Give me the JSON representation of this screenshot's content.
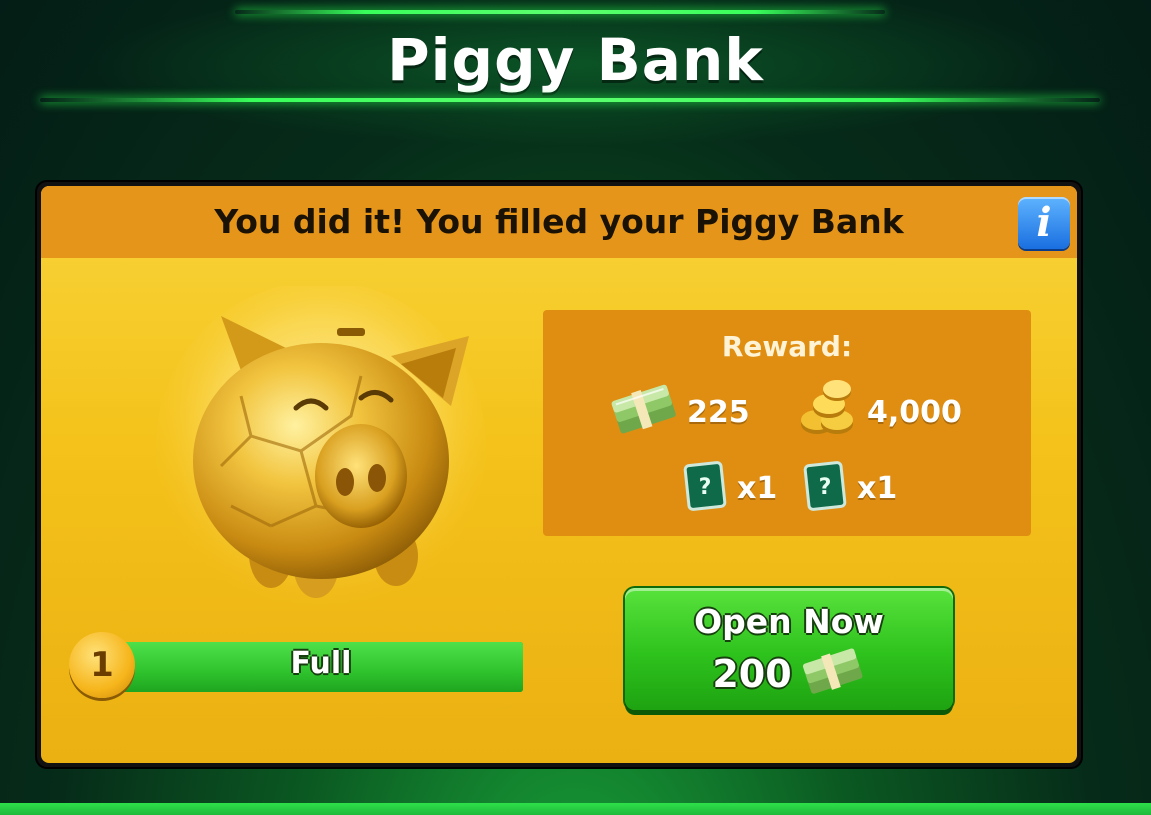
{
  "title": "Piggy Bank",
  "panel": {
    "header_text": "You did it! You filled your Piggy Bank",
    "info_icon_glyph": "i"
  },
  "reward": {
    "title": "Reward:",
    "items": [
      {
        "icon": "cash-stack-icon",
        "value": "225"
      },
      {
        "icon": "gold-coins-icon",
        "value": "4,000"
      },
      {
        "icon": "mystery-card-icon",
        "value": "x1"
      },
      {
        "icon": "mystery-card-icon",
        "value": "x1"
      }
    ]
  },
  "progress": {
    "level": "1",
    "label": "Full",
    "fill_fraction": 1.0
  },
  "open_button": {
    "label": "Open Now",
    "price": "200",
    "price_icon": "cash-stack-icon"
  },
  "colors": {
    "panel_yellow": "#f4c21a",
    "header_orange": "#e5951a",
    "reward_box": "#e08e12",
    "button_green": "#2ec21d",
    "info_blue": "#1a6fe0"
  }
}
